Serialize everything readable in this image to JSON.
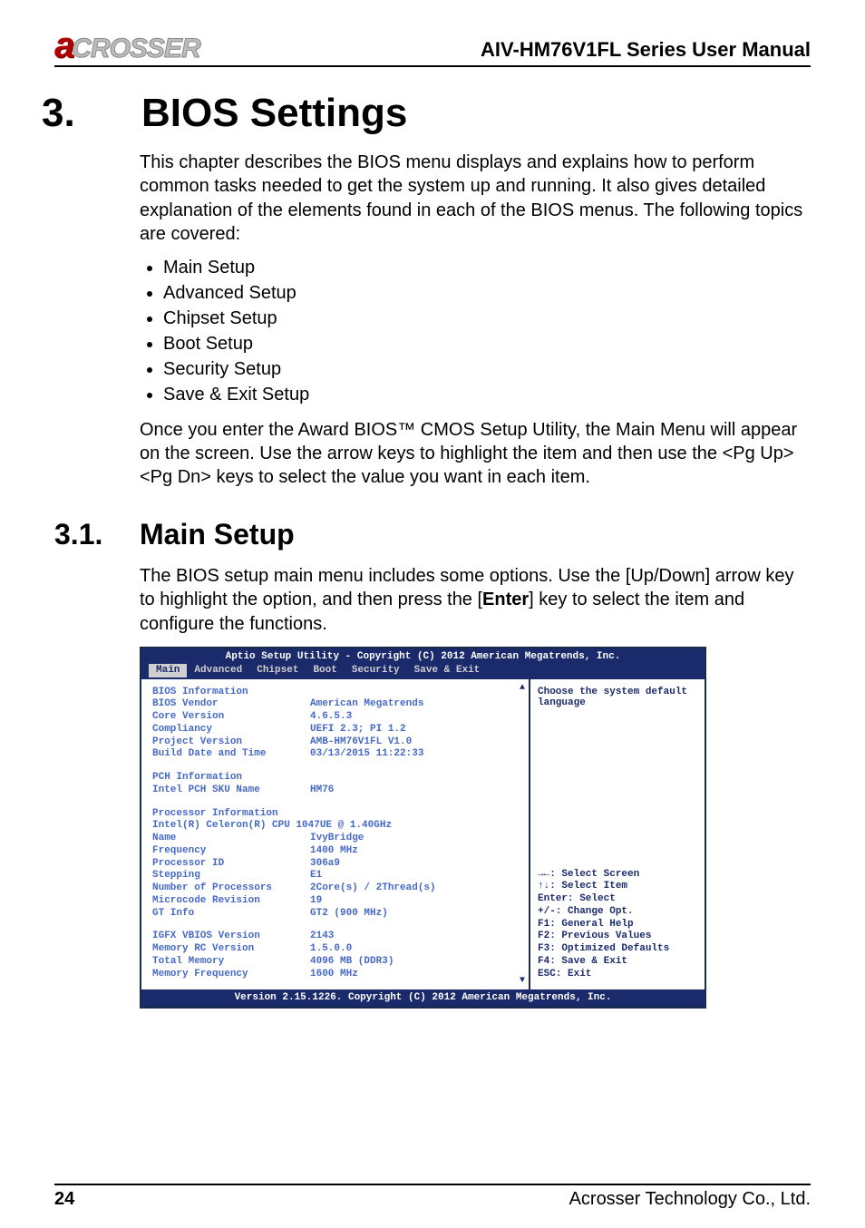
{
  "header": {
    "logo_red": "a",
    "logo_gray": "CROSSER",
    "manual_title": "AIV-HM76V1FL Series User Manual"
  },
  "chapter": {
    "number": "3.",
    "title": "BIOS Settings"
  },
  "intro_paragraph": "This chapter describes the BIOS menu displays and explains how to perform common tasks needed to get the system up and running. It also gives detailed explanation of the elements found in each of the BIOS menus. The following topics are covered:",
  "bullets": [
    "Main Setup",
    "Advanced Setup",
    "Chipset Setup",
    "Boot Setup",
    "Security Setup",
    "Save & Exit Setup"
  ],
  "intro_paragraph2": "Once you enter the Award BIOS™ CMOS Setup Utility, the Main Menu will appear on the screen. Use the arrow keys to highlight the item and then use the <Pg Up> <Pg Dn> keys to select the value you want in each item.",
  "subchapter": {
    "number": "3.1.",
    "title": "Main Setup"
  },
  "sub_paragraph_before_bold": "The BIOS setup main menu includes some options. Use the [Up/Down] arrow key to highlight the option, and then press the [",
  "sub_paragraph_bold": "Enter",
  "sub_paragraph_after_bold": "] key to select the item and configure the functions.",
  "bios": {
    "title": "Aptio Setup Utility - Copyright (C) 2012 American Megatrends, Inc.",
    "tabs": [
      "Main",
      "Advanced",
      "Chipset",
      "Boot",
      "Security",
      "Save & Exit"
    ],
    "active_tab": 0,
    "sections": {
      "bios_info_header": "BIOS Information",
      "bios_info": [
        {
          "label": "BIOS Vendor",
          "value": "American Megatrends"
        },
        {
          "label": "Core Version",
          "value": "4.6.5.3"
        },
        {
          "label": "Compliancy",
          "value": "UEFI 2.3; PI 1.2"
        },
        {
          "label": "Project Version",
          "value": "AMB-HM76V1FL V1.0"
        },
        {
          "label": "Build Date and Time",
          "value": "03/13/2015 11:22:33"
        }
      ],
      "pch_info_header": "PCH Information",
      "pch_info": [
        {
          "label": "Intel PCH SKU Name",
          "value": "HM76"
        }
      ],
      "proc_info_header": "Processor Information",
      "proc_line": "Intel(R) Celeron(R) CPU 1047UE @ 1.40GHz",
      "proc_info": [
        {
          "label": "Name",
          "value": "IvyBridge"
        },
        {
          "label": "Frequency",
          "value": "1400 MHz"
        },
        {
          "label": "Processor ID",
          "value": "306a9"
        },
        {
          "label": "Stepping",
          "value": "E1"
        },
        {
          "label": "Number of Processors",
          "value": "2Core(s) / 2Thread(s)"
        },
        {
          "label": "Microcode Revision",
          "value": "19"
        },
        {
          "label": "GT Info",
          "value": "GT2 (900 MHz)"
        }
      ],
      "mem_info": [
        {
          "label": "IGFX VBIOS Version",
          "value": "2143"
        },
        {
          "label": "Memory RC Version",
          "value": "1.5.0.0"
        },
        {
          "label": "Total Memory",
          "value": "4096 MB (DDR3)"
        },
        {
          "label": "Memory Frequency",
          "value": "1600 MHz"
        }
      ]
    },
    "help_top": "Choose the system default language",
    "help_bottom": [
      "→←: Select Screen",
      "↑↓: Select Item",
      "Enter: Select",
      "+/-: Change Opt.",
      "F1: General Help",
      "F2: Previous Values",
      "F3: Optimized Defaults",
      "F4: Save & Exit",
      "ESC: Exit"
    ],
    "bottom": "Version 2.15.1226. Copyright (C) 2012 American Megatrends, Inc."
  },
  "footer": {
    "page": "24",
    "company": "Acrosser Technology Co., Ltd."
  }
}
